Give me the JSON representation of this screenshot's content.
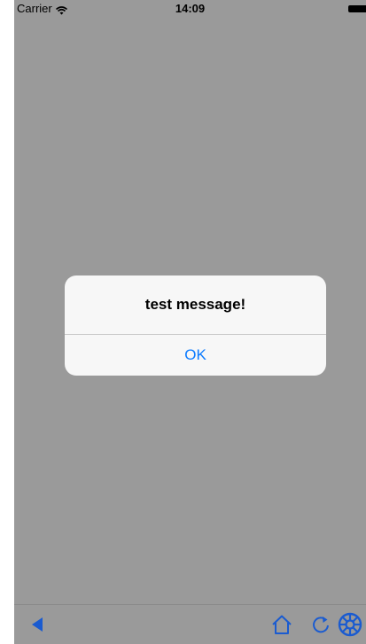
{
  "status_bar": {
    "carrier": "Carrier",
    "time": "14:09",
    "icons": [
      "wifi-icon",
      "battery-icon"
    ]
  },
  "alert": {
    "message": "test message!",
    "ok_label": "OK"
  },
  "toolbar": {
    "icons": [
      "back-arrow-icon",
      "home-icon",
      "reload-icon",
      "settings-wheel-icon"
    ]
  },
  "colors": {
    "dimmed_background": "#9a9a9a",
    "ios_blue": "#0a7aff",
    "toolbar_icon_blue": "#1a5bd0",
    "alert_background": "#f7f7f7"
  }
}
